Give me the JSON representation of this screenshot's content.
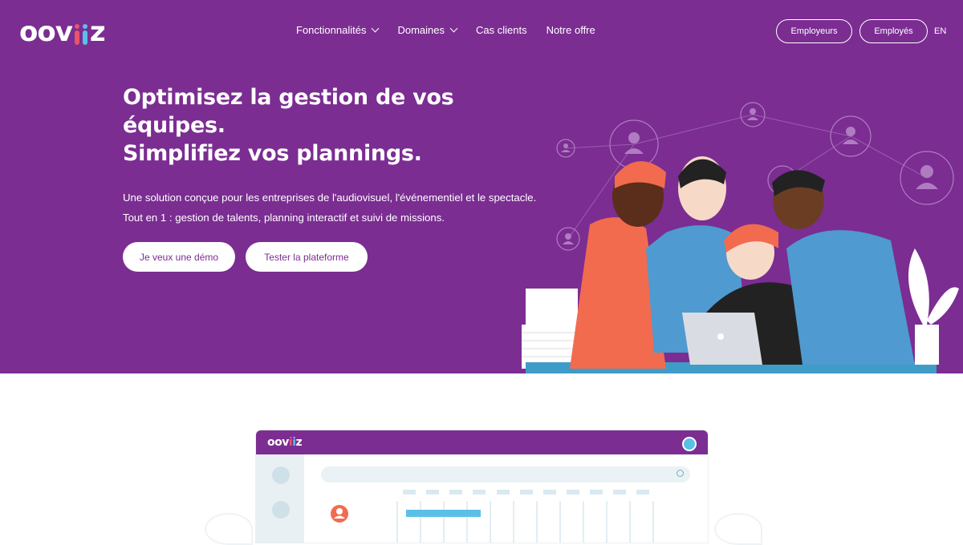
{
  "brand": {
    "logo_text_left": "oov",
    "logo_text_right": "z",
    "colors": {
      "primary": "#7b2d92",
      "accent_pink": "#e9546b",
      "accent_blue": "#5bc0e8"
    }
  },
  "nav": {
    "items": [
      {
        "label": "Fonctionnalités",
        "has_dropdown": true
      },
      {
        "label": "Domaines",
        "has_dropdown": true
      },
      {
        "label": "Cas clients",
        "has_dropdown": false
      },
      {
        "label": "Notre offre",
        "has_dropdown": false
      }
    ],
    "employeurs_label": "Employeurs",
    "employes_label": "Employés",
    "lang_label": "EN"
  },
  "hero": {
    "headline": [
      "Optimisez la gestion de vos",
      "équipes.",
      "Simplifiez vos plannings."
    ],
    "sub_lines": [
      "Une solution conçue pour les entreprises de l'audiovisuel, l'événementiel et le spectacle.",
      "Tout en 1 : gestion de talents, planning interactif et suivi de missions."
    ],
    "cta_demo": "Je veux une démo",
    "cta_test": "Tester la plateforme"
  },
  "mockup": {
    "logo_text": "oov",
    "logo_text_right": "z"
  }
}
